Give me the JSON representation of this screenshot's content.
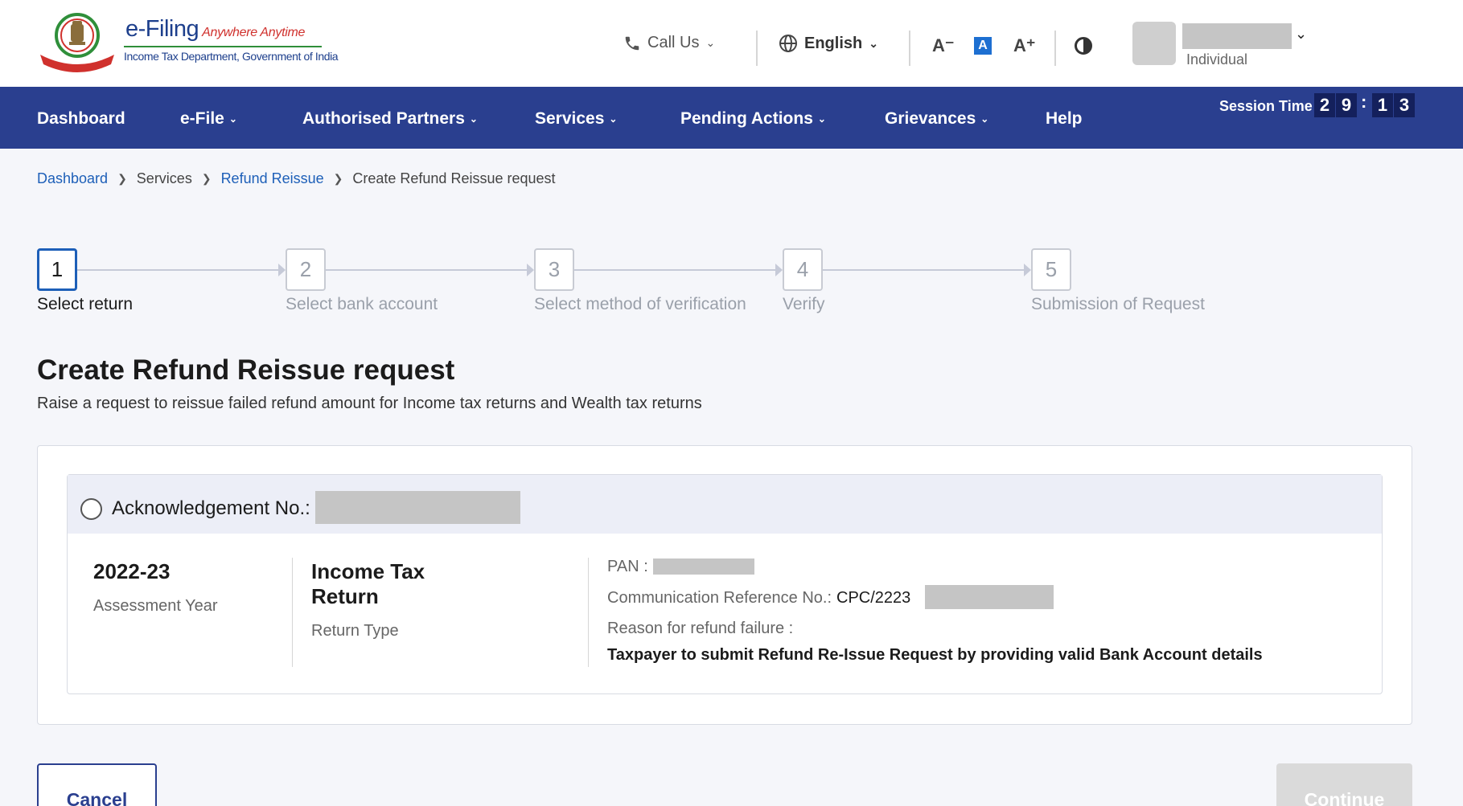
{
  "header": {
    "brand_title": "e-Filing",
    "brand_tagline": "Anywhere Anytime",
    "brand_subtitle": "Income Tax Department, Government of India",
    "emblem_text": "INCOME TAX DEPARTMENT",
    "call_us": "Call Us",
    "language": "English",
    "font_decrease": "A⁻",
    "font_normal": "A",
    "font_increase": "A⁺",
    "user_role": "Individual"
  },
  "nav": {
    "items": [
      {
        "label": "Dashboard"
      },
      {
        "label": "e-File"
      },
      {
        "label": "Authorised Partners"
      },
      {
        "label": "Services"
      },
      {
        "label": "Pending Actions"
      },
      {
        "label": "Grievances"
      },
      {
        "label": "Help"
      }
    ],
    "session_label": "Session Time",
    "session_digits": [
      "2",
      "9",
      "1",
      "3"
    ]
  },
  "breadcrumb": [
    "Dashboard",
    "Services",
    "Refund Reissue",
    "Create Refund Reissue request"
  ],
  "stepper": [
    {
      "num": "1",
      "label": "Select return"
    },
    {
      "num": "2",
      "label": "Select bank account"
    },
    {
      "num": "3",
      "label": "Select method of verification"
    },
    {
      "num": "4",
      "label": "Verify"
    },
    {
      "num": "5",
      "label": "Submission of Request"
    }
  ],
  "page": {
    "title": "Create Refund Reissue request",
    "subtitle": "Raise a request to reissue failed refund amount for Income tax returns and Wealth tax returns"
  },
  "return_card": {
    "ack_label": "Acknowledgement No.:",
    "assessment_year": "2022-23",
    "assessment_year_label": "Assessment Year",
    "return_type": "Income Tax Return",
    "return_type_label": "Return Type",
    "pan_label": "PAN :",
    "comm_ref_label": "Communication Reference No.:",
    "comm_ref_value": "CPC/2223",
    "reason_label": "Reason for refund failure :",
    "reason_value": "Taxpayer to submit Refund Re-Issue Request by providing valid Bank Account details"
  },
  "actions": {
    "cancel": "Cancel",
    "continue": "Continue"
  },
  "colors": {
    "nav_bg": "#2a3f8f",
    "accent": "#1d5fb8",
    "page_bg": "#f5f6fa"
  }
}
